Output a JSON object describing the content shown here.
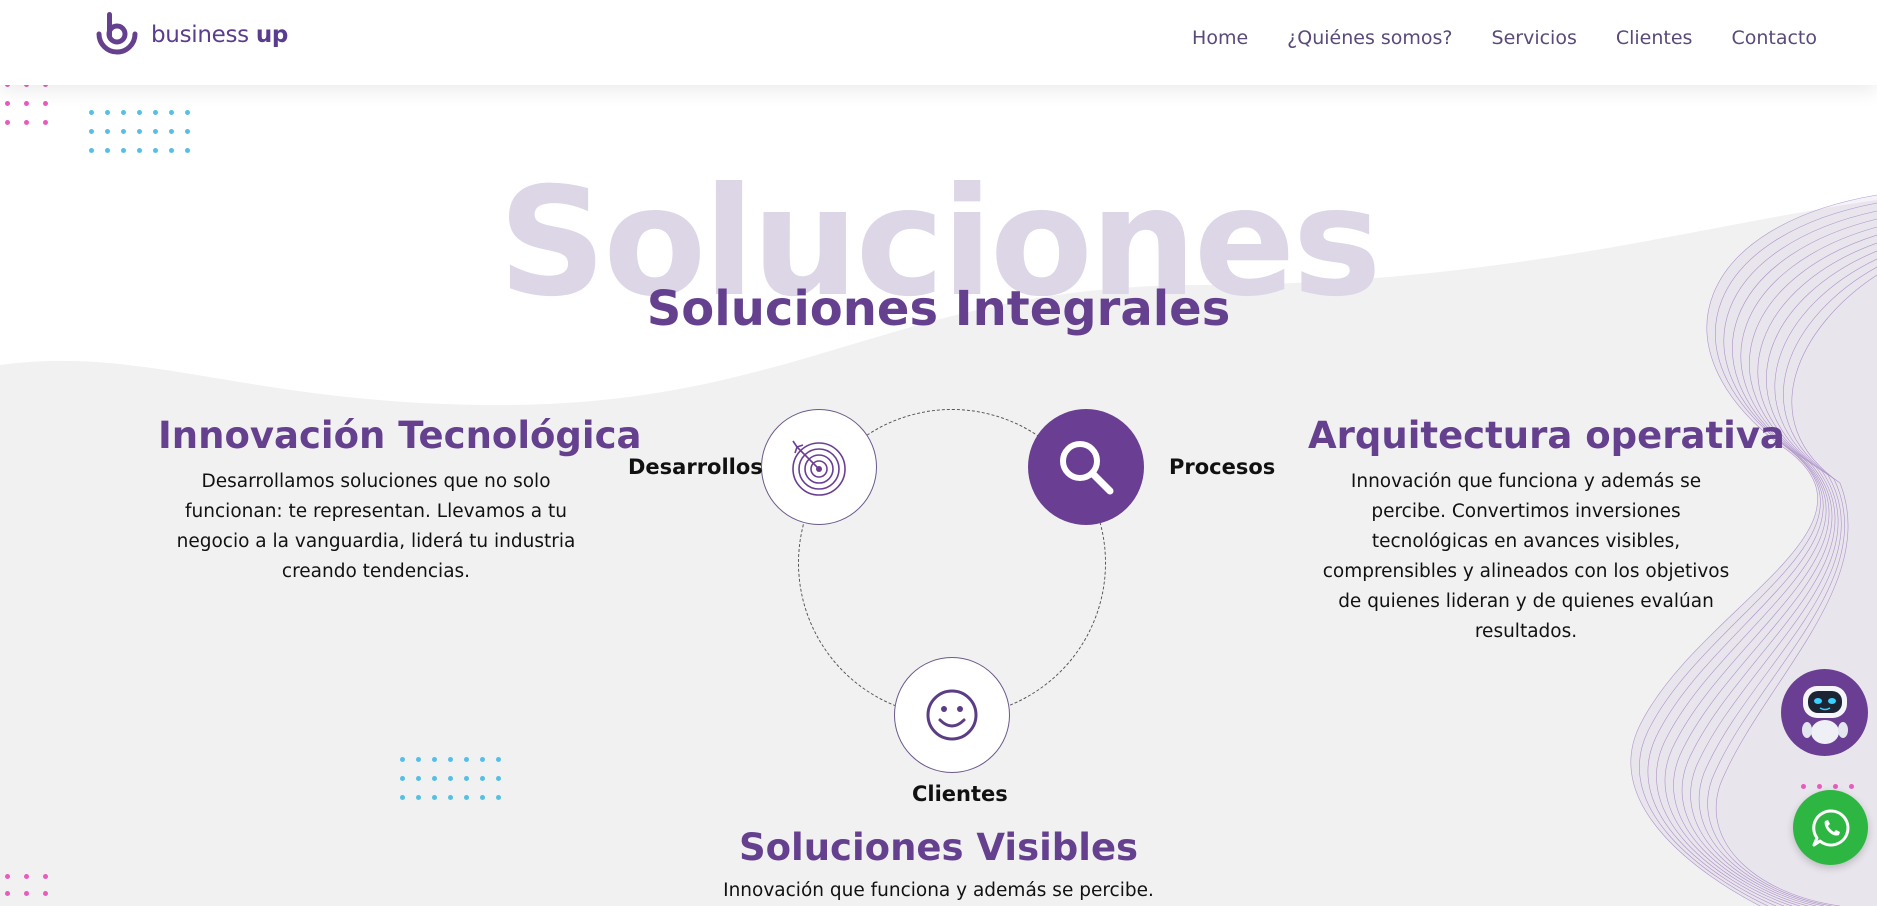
{
  "header": {
    "logo_text_regular": "business ",
    "logo_text_bold": "up",
    "nav": [
      "Home",
      "¿Quiénes somos?",
      "Servicios",
      "Clientes",
      "Contacto"
    ]
  },
  "hero": {
    "background_word": "Soluciones",
    "title": "Soluciones Integrales"
  },
  "left_column": {
    "title": "Innovación Tecnológica",
    "text": "Desarrollamos soluciones que no solo funcionan: te representan. Llevamos a tu negocio a la vanguardia, liderá tu industria creando tendencias."
  },
  "right_column": {
    "title": "Arquitectura operativa",
    "text": "Innovación que funciona y además se percibe. Convertimos inversiones tecnológicas en avances visibles, comprensibles y alineados con los objetivos de quienes lideran y de quienes evalúan resultados."
  },
  "diagram": {
    "nodes": [
      {
        "label": "Desarrollos",
        "icon": "target-icon"
      },
      {
        "label": "Procesos",
        "icon": "search-icon"
      },
      {
        "label": "Clientes",
        "icon": "smiley-icon"
      }
    ]
  },
  "bottom": {
    "title": "Soluciones Visibles",
    "text": "Innovación que funciona y además se percibe."
  },
  "floating": {
    "bot_icon": "robot-icon",
    "whatsapp_icon": "whatsapp-icon"
  },
  "colors": {
    "brand_purple": "#65408f",
    "light_purple": "#dcd6e7",
    "whatsapp_green": "#2db742",
    "dot_pink": "#e85bbd",
    "dot_blue": "#55bfe6"
  }
}
